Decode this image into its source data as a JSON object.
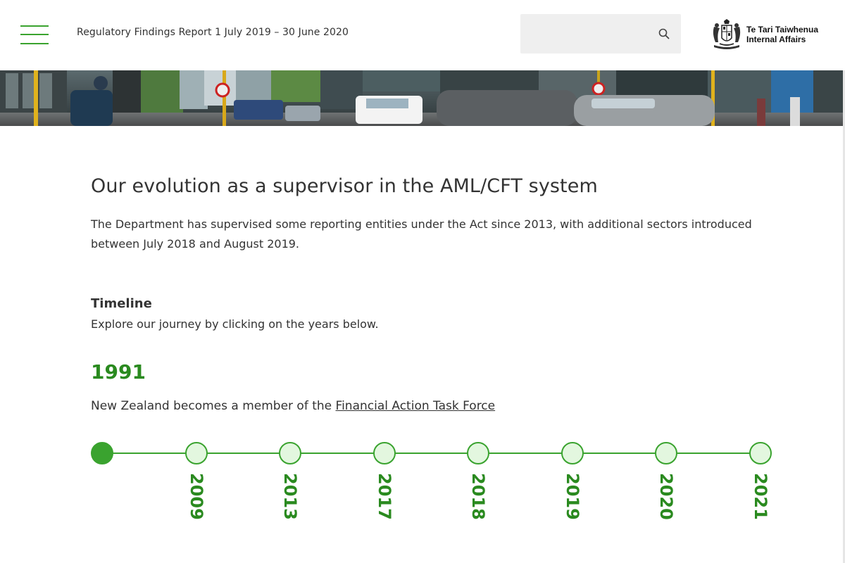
{
  "header": {
    "report_title": "Regulatory Findings Report 1 July 2019 – 30 June 2020",
    "search": {
      "placeholder": "",
      "icon": "search-icon"
    },
    "logo": {
      "line1": "Te Tari Taiwhenua",
      "line2": "Internal Affairs",
      "icon": "nz-coat-of-arms"
    },
    "menu_icon": "hamburger-menu-icon"
  },
  "main": {
    "heading": "Our evolution as a supervisor in the AML/CFT system",
    "intro": "The Department has supervised some reporting entities under the Act since 2013, with additional sectors introduced between July 2018 and August 2019.",
    "timeline": {
      "title": "Timeline",
      "subtitle": "Explore our journey by clicking on the years below.",
      "selected_year": "1991",
      "event_prefix": "New Zealand becomes a member of the ",
      "event_link": "Financial Action Task Force",
      "years": [
        "1991",
        "2009",
        "2013",
        "2017",
        "2018",
        "2019",
        "2020",
        "2021"
      ]
    }
  },
  "colors": {
    "accent": "#3aa32f",
    "year_text": "#2a8a1f",
    "dot_fill": "#e3f7df",
    "search_bg": "#efefef"
  }
}
